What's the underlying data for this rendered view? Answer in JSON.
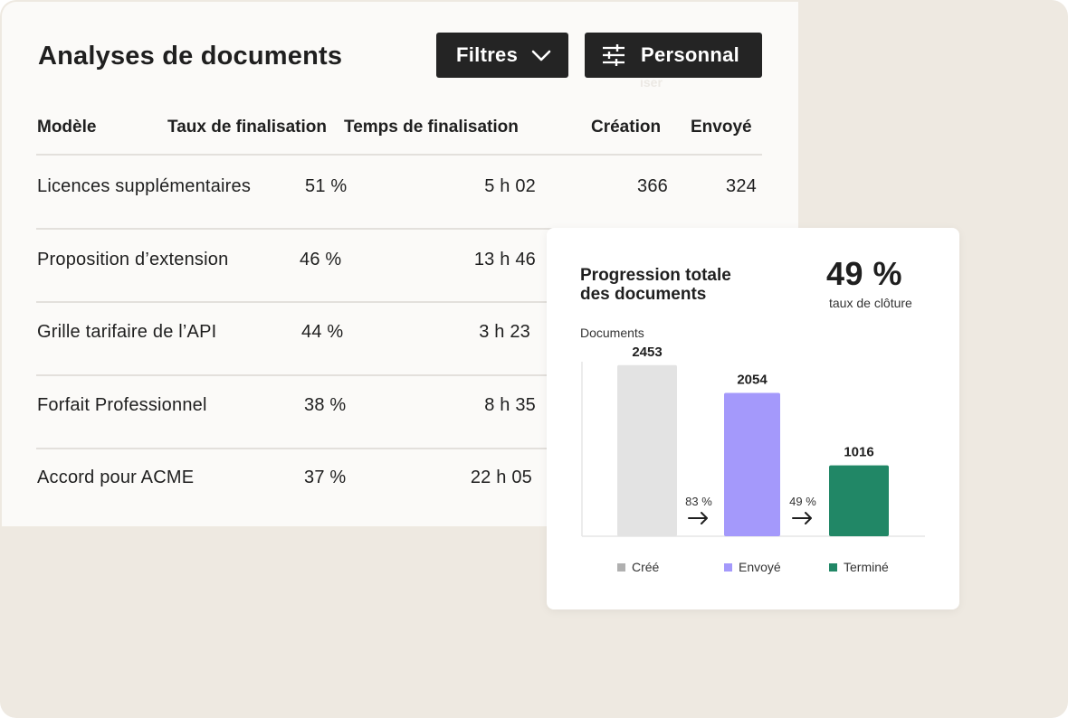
{
  "page": {
    "title": "Analyses de documents",
    "filters_label": "Filtres",
    "custom_label": "Personnal",
    "custom_overflow": "iser"
  },
  "table": {
    "columns": [
      "Modèle",
      "Taux de finalisation",
      "Temps de finalisation",
      "Création",
      "Envoyé"
    ],
    "rows": [
      {
        "model": "Licences supplémentaires",
        "rate": "51 %",
        "time": "5 h 02",
        "created": "366",
        "sent": "324"
      },
      {
        "model": "Proposition d’extension",
        "rate": "46 %",
        "time": "13 h 46",
        "created": "",
        "sent": ""
      },
      {
        "model": "Grille tarifaire de l’API",
        "rate": "44 %",
        "time": "3 h 23",
        "created": "",
        "sent": ""
      },
      {
        "model": "Forfait Professionnel",
        "rate": "38 %",
        "time": "8 h 35",
        "created": "",
        "sent": ""
      },
      {
        "model": "Accord pour ACME",
        "rate": "37 %",
        "time": "22 h 05",
        "created": "",
        "sent": ""
      }
    ]
  },
  "card": {
    "title_line1": "Progression totale",
    "title_line2": "des documents",
    "rate_value": "49 %",
    "rate_label": "taux de clôture",
    "y_label": "Documents"
  },
  "colors": {
    "button_bg": "#242424",
    "bar_created": "#e3e3e3",
    "bar_sent": "#a499fb",
    "bar_done": "#218766",
    "legend_created": "#b0b0b0"
  },
  "chart_data": {
    "type": "bar",
    "categories": [
      "Créé",
      "Envoyé",
      "Terminé"
    ],
    "values": [
      2453,
      2054,
      1016
    ],
    "ylabel": "Documents",
    "ylim": [
      0,
      2800
    ],
    "conversions": [
      "83 %",
      "49 %"
    ],
    "legend": [
      "Créé",
      "Envoyé",
      "Terminé"
    ],
    "legend_position": "bottom",
    "grid": false
  }
}
